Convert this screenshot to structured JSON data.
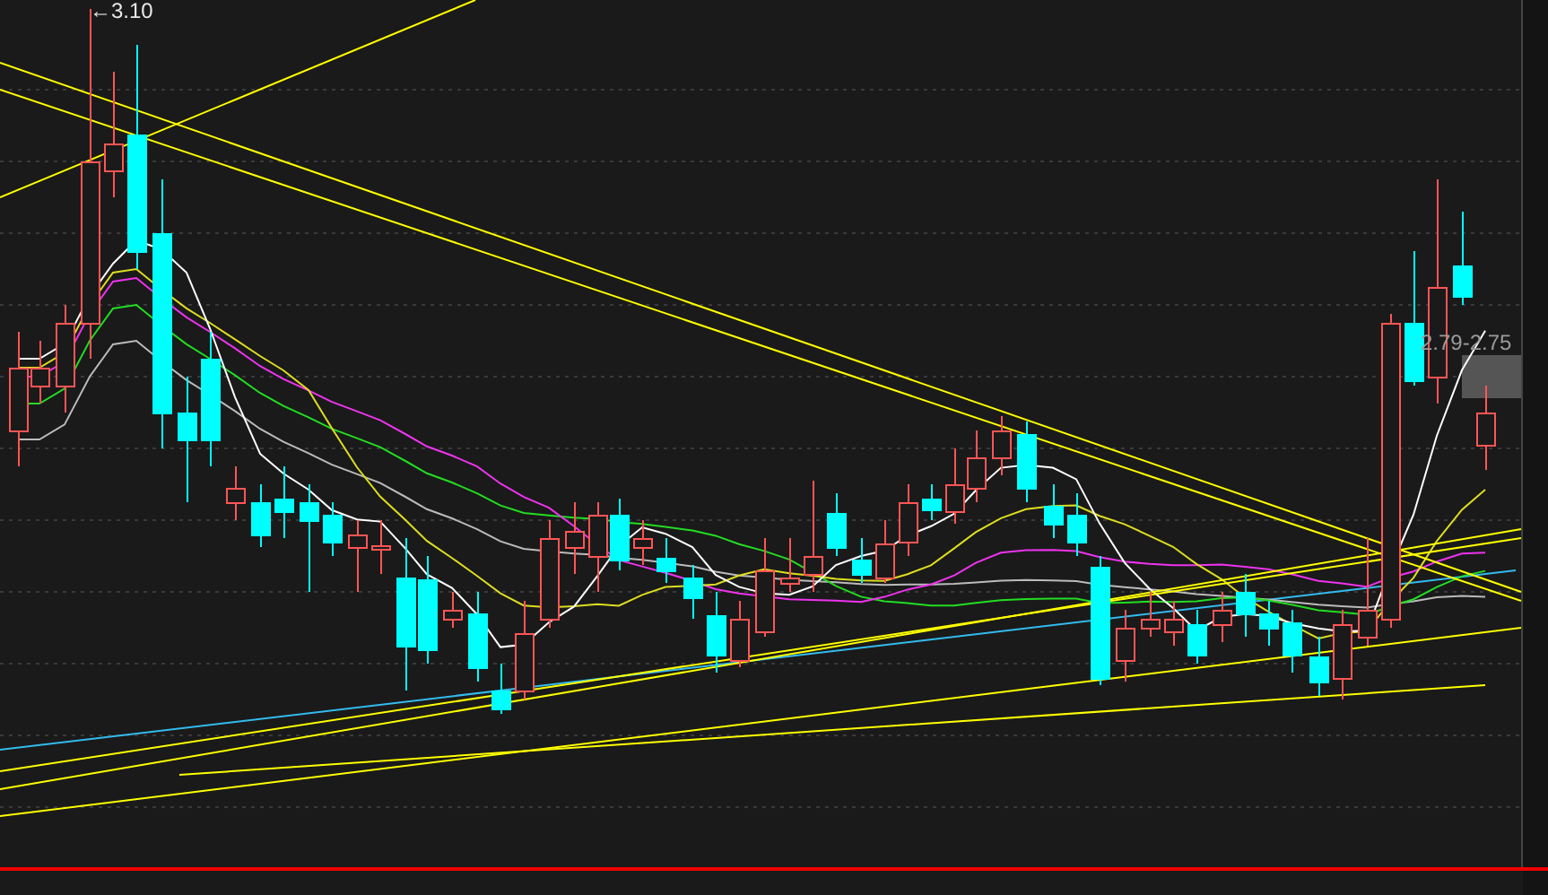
{
  "chart": {
    "high_label": "←3.10",
    "range_label": "2.79-2.75"
  }
}
